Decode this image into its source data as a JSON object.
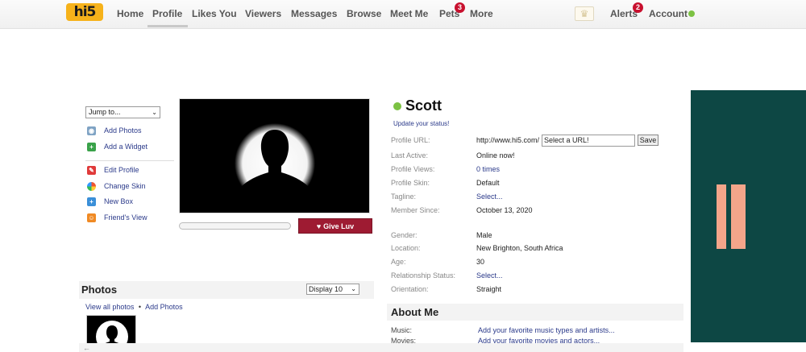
{
  "nav": {
    "logo": "hi5",
    "items": [
      "Home",
      "Profile",
      "Likes You",
      "Viewers",
      "Messages",
      "Browse",
      "Meet Me",
      "Pets",
      "More"
    ],
    "pets_badge": "3",
    "alerts_label": "Alerts",
    "alerts_badge": "2",
    "account_label": "Account",
    "crown_icon": "crown-icon",
    "online_color": "#7cc243"
  },
  "sidebar": {
    "jump_select": "Jump to...",
    "links": [
      "Add Photos",
      "Add a Widget",
      "Edit Profile",
      "Change Skin",
      "New Box",
      "Friend's View"
    ]
  },
  "photo": {
    "give_luv_label": "Give Luv"
  },
  "photos": {
    "title": "Photos",
    "display_select": "Display 10",
    "view_all": "View all photos",
    "separator": "•",
    "add_photos": "Add Photos"
  },
  "profile": {
    "name": "Scott",
    "status_link": "Update your status!",
    "url_label": "Profile URL:",
    "url_prefix": "http://www.hi5.com/",
    "url_placeholder": "Select a URL!",
    "save_label": "Save",
    "fields": [
      {
        "label": "Last Active:",
        "value": "Online now!"
      },
      {
        "label": "Profile Views:",
        "value": "0 times"
      },
      {
        "label": "Profile Skin:",
        "value": "Default"
      },
      {
        "label": "Tagline:",
        "value": "Select..."
      },
      {
        "label": "Member Since:",
        "value": "October 13, 2020"
      },
      {
        "label": "Gender:",
        "value": "Male"
      },
      {
        "label": "Location:",
        "value": "New Brighton, South Africa"
      },
      {
        "label": "Age:",
        "value": "30"
      },
      {
        "label": "Relationship Status:",
        "value": "Select..."
      },
      {
        "label": "Orientation:",
        "value": "Straight"
      }
    ]
  },
  "about": {
    "title": "About Me",
    "rows": [
      {
        "label": "Music:",
        "value": "Add your favorite music types and artists..."
      },
      {
        "label": "Movies:",
        "value": "Add your favorite movies and actors..."
      }
    ]
  },
  "colors": {
    "give_luv": "#9e1b32",
    "ad_background": "#0d4744",
    "ad_accent": "#f3a58a",
    "link": "#2b3a8a"
  }
}
